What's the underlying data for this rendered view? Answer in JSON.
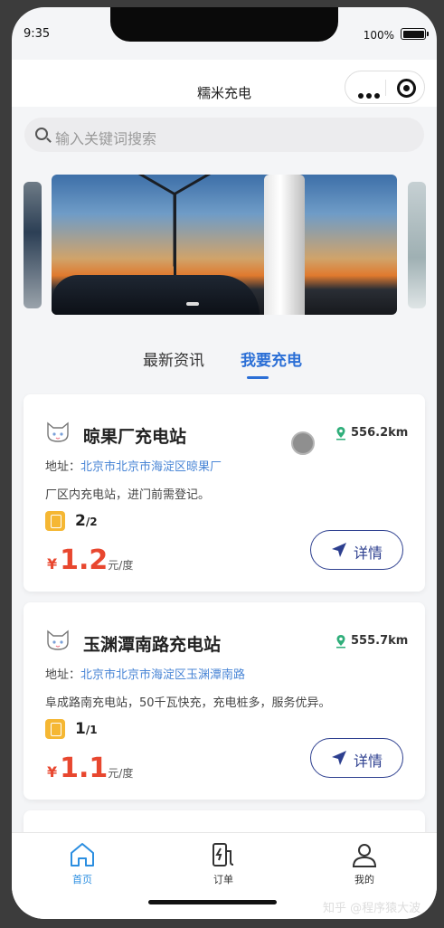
{
  "status_bar": {
    "time": "9:35",
    "battery": "100%"
  },
  "nav": {
    "title": "糯米充电"
  },
  "search": {
    "placeholder": "输入关键词搜索"
  },
  "tabs": [
    {
      "label": "最新资讯",
      "active": false
    },
    {
      "label": "我要充电",
      "active": true
    }
  ],
  "stations": [
    {
      "name": "晾果厂充电站",
      "distance": "556.2km",
      "address_label": "地址：",
      "address": "北京市北京市海淀区晾果厂",
      "description": "厂区内充电站，进门前需登记。",
      "slots_free": "2",
      "slots_total": "/2",
      "currency": "¥",
      "price": "1.2",
      "unit": "元/度",
      "detail_label": "详情"
    },
    {
      "name": "玉渊潭南路充电站",
      "distance": "555.7km",
      "address_label": "地址：",
      "address": "北京市北京市海淀区玉渊潭南路",
      "description": "阜成路南充电站，50千瓦快充，充电桩多，服务优异。",
      "slots_free": "1",
      "slots_total": "/1",
      "currency": "¥",
      "price": "1.1",
      "unit": "元/度",
      "detail_label": "详情"
    }
  ],
  "tabbar": {
    "home": "首页",
    "orders": "订单",
    "mine": "我的"
  },
  "watermark": "知乎 @程序猿大波",
  "colors": {
    "accent": "#2b6fd6",
    "price": "#e8472f",
    "address": "#4a86d6",
    "detail_button": "#2d3f8f",
    "tab_active": "#2b8ee0"
  }
}
